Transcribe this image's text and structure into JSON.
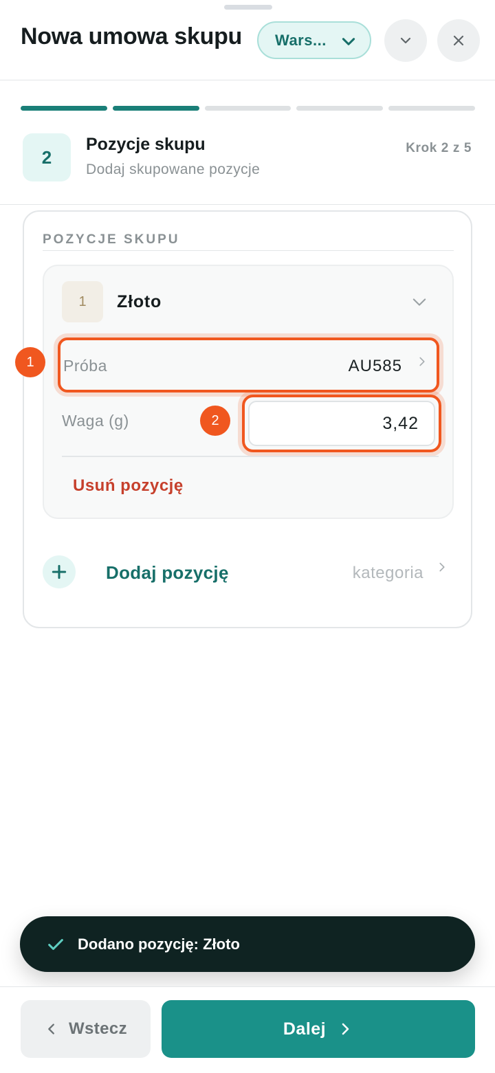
{
  "header": {
    "title": "Nowa umowa skupu",
    "branch_selector": "Wars...",
    "collapse_icon": "chevron-down-icon",
    "close_icon": "close-icon"
  },
  "progress": {
    "total_steps": 5,
    "completed_steps": 2
  },
  "step": {
    "number": "2",
    "title": "Pozycje skupu",
    "subtitle": "Dodaj skupowane pozycje",
    "counter": "Krok 2 z 5"
  },
  "section": {
    "label": "POZYCJE SKUPU",
    "item": {
      "index": "1",
      "name": "Złoto",
      "probe_label": "Próba",
      "probe_value": "AU585",
      "weight_label": "Waga (g)",
      "weight_value": "3,42",
      "remove_label": "Usuń pozycję"
    },
    "add": {
      "label": "Dodaj pozycję",
      "category": "kategoria"
    }
  },
  "markers": {
    "m1": "1",
    "m2": "2"
  },
  "toast": {
    "message": "Dodano pozycję: Złoto"
  },
  "footer": {
    "back_label": "Wstecz",
    "next_label": "Dalej"
  },
  "colors": {
    "accent": "#1a9189",
    "accent_dark": "#176f69",
    "highlight": "#f0571f",
    "danger": "#c6402c",
    "toast_bg": "#0f2322"
  }
}
